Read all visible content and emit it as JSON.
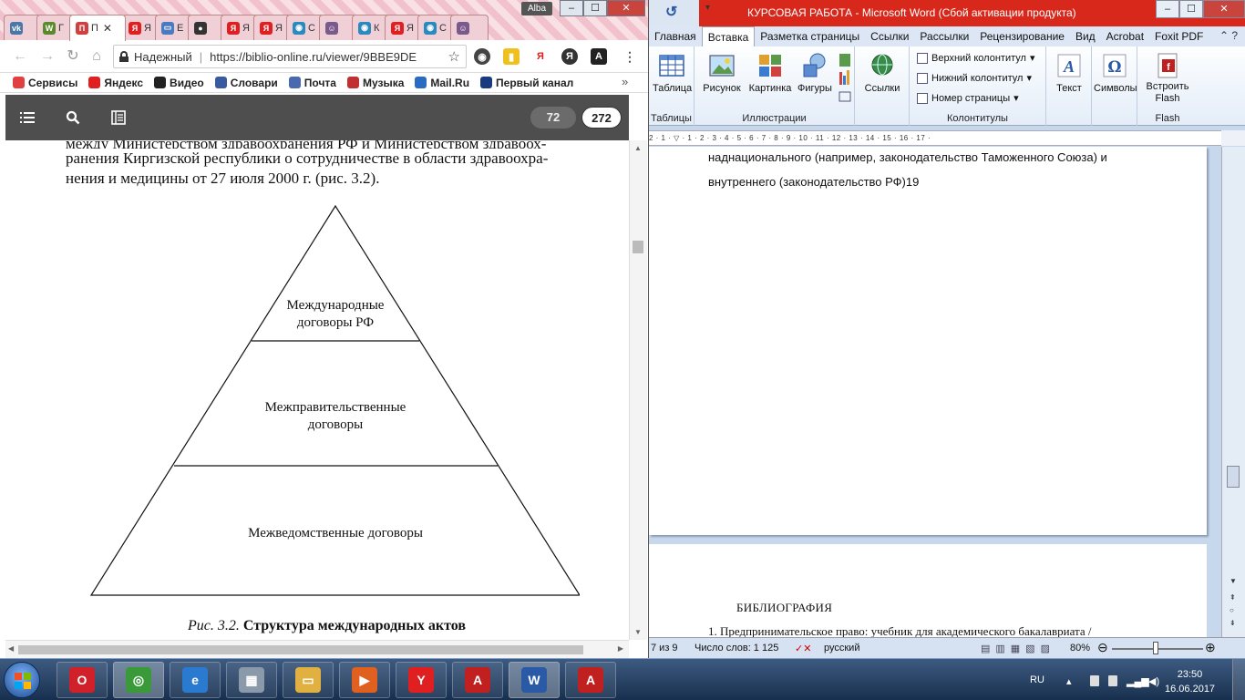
{
  "chrome": {
    "tabs": [
      {
        "short": "",
        "icon": "vk-icon",
        "color": "#4a76a8",
        "glyph": "vk"
      },
      {
        "short": "Г",
        "icon": "green-flag-icon",
        "color": "#5a8a2a",
        "glyph": "W"
      },
      {
        "short": "П",
        "icon": "book-icon",
        "color": "#d04040",
        "glyph": "П",
        "active": true
      },
      {
        "short": "Я",
        "icon": "yandex-icon",
        "color": "#e02020",
        "glyph": "Я"
      },
      {
        "short": "Е",
        "icon": "doc-icon",
        "color": "#4a7ac0",
        "glyph": "▭"
      },
      {
        "short": "",
        "icon": "person-icon",
        "color": "#333333",
        "glyph": "●"
      },
      {
        "short": "Я",
        "icon": "yandex-icon",
        "color": "#e02020",
        "glyph": "Я"
      },
      {
        "short": "Я",
        "icon": "yandex-icon",
        "color": "#e02020",
        "glyph": "Я"
      },
      {
        "short": "С",
        "icon": "globe-icon",
        "color": "#2a8ac0",
        "glyph": "◉"
      },
      {
        "short": "",
        "icon": "avatar-icon",
        "color": "#7a5a8a",
        "glyph": "☺"
      },
      {
        "short": "К",
        "icon": "globe-icon",
        "color": "#2a8ac0",
        "glyph": "◉"
      },
      {
        "short": "Я",
        "icon": "yandex-icon",
        "color": "#e02020",
        "glyph": "Я"
      },
      {
        "short": "С",
        "icon": "globe-icon",
        "color": "#2a8ac0",
        "glyph": "◉"
      },
      {
        "short": "",
        "icon": "avatar-icon",
        "color": "#7a5a8a",
        "glyph": "☺"
      }
    ],
    "active_tab_close": "✕",
    "profile": "Alba",
    "window_controls": {
      "minimize": "–",
      "maximize": "☐",
      "close": "✕"
    },
    "address": {
      "security_label": "Надежный",
      "url": "https://biblio-online.ru/viewer/9BBE9DE"
    },
    "bookmarks": [
      {
        "label": "Сервисы",
        "icon": "apps-grid-icon",
        "color": "#e04040"
      },
      {
        "label": "Яндекс",
        "icon": "yandex-icon",
        "color": "#e02020"
      },
      {
        "label": "Видео",
        "icon": "video-icon",
        "color": "#222222"
      },
      {
        "label": "Словари",
        "icon": "dictionary-icon",
        "color": "#3a5aa0"
      },
      {
        "label": "Почта",
        "icon": "mail-icon",
        "color": "#4a6ab0"
      },
      {
        "label": "Музыка",
        "icon": "music-icon",
        "color": "#c03030"
      },
      {
        "label": "Mail.Ru",
        "icon": "mailru-icon",
        "color": "#2a6ac0"
      },
      {
        "label": "Первый канал",
        "icon": "channel-one-icon",
        "color": "#1a3a80"
      }
    ],
    "bookmarks_more": "»",
    "reader": {
      "current_page": "72",
      "total_pages": "272"
    },
    "document": {
      "line_cut": "между Министерством здравоохранения РФ и Министерством здравоох-",
      "line2": "ранения Киргизской республики о сотрудничестве в области здравоохра-",
      "line3": "нения и медицины от 27 июля 2000 г. (рис. 3.2).",
      "pyramid_levels": {
        "top_line1": "Международные",
        "top_line2": "договоры РФ",
        "middle_line1": "Межправительственные",
        "middle_line2": "договоры",
        "bottom": "Межведомственные договоры"
      },
      "caption_number": "Рис. 3.2.",
      "caption_title": "Структура международных актов"
    }
  },
  "word": {
    "title": "КУРСОВАЯ РАБОТА  -  Microsoft Word (Сбой активации продукта)",
    "qat_icon": "undo-icon",
    "window_controls": {
      "minimize": "–",
      "maximize": "☐",
      "close": "✕"
    },
    "tabs": [
      "Главная",
      "Вставка",
      "Разметка страницы",
      "Ссылки",
      "Рассылки",
      "Рецензирование",
      "Вид",
      "Acrobat",
      "Foxit PDF"
    ],
    "active_tab": "Вставка",
    "ribbon": {
      "tables": {
        "button": "Таблица",
        "group": "Таблицы"
      },
      "illustrations": {
        "picture": "Рисунок",
        "clipart": "Картинка",
        "shapes": "Фигуры",
        "group": "Иллюстрации"
      },
      "links": {
        "button": "Ссылки"
      },
      "header_footer": {
        "header": "Верхний колонтитул",
        "footer": "Нижний колонтитул",
        "page_number": "Номер страницы",
        "group": "Колонтитулы"
      },
      "text": {
        "button": "Текст"
      },
      "symbols": {
        "button": "Символы"
      },
      "flash": {
        "button_line1": "Встроить",
        "button_line2": "Flash",
        "group": "Flash"
      }
    },
    "ruler": "2 · 1 · ▽ · 1 · 2 · 3 · 4 · 5 · 6 · 7 · 8 · 9 · 10 · 11 · 12 · 13 · 14 · 15 · 16 · 17 ·",
    "page1_text": {
      "line1": "наднационального (например, законодательство Таможенного Союза) и",
      "line2": "внутреннего (законодательство РФ)19"
    },
    "page2": {
      "heading": "БИБЛИОГРАФИЯ",
      "item1": "1.  Предпринимательское право: учебник для академического бакалавриата /"
    },
    "status": {
      "page": "7 из 9",
      "words": "Число слов: 1 125",
      "language": "русский",
      "zoom": "80%",
      "zoom_level_percent": 80
    }
  },
  "taskbar": {
    "apps": [
      {
        "name": "opera",
        "icon": "opera-icon",
        "color": "#d0202a",
        "glyph": "O"
      },
      {
        "name": "chrome",
        "icon": "chrome-icon",
        "color": "#3a9a3a",
        "glyph": "◎",
        "active": true
      },
      {
        "name": "ie",
        "icon": "internet-explorer-icon",
        "color": "#2a7ad0",
        "glyph": "e"
      },
      {
        "name": "calculator",
        "icon": "calculator-icon",
        "color": "#8a9aaa",
        "glyph": "▦"
      },
      {
        "name": "explorer",
        "icon": "folder-icon",
        "color": "#e0b040",
        "glyph": "▭"
      },
      {
        "name": "media",
        "icon": "media-player-icon",
        "color": "#e06020",
        "glyph": "▶"
      },
      {
        "name": "yandex",
        "icon": "yandex-browser-icon",
        "color": "#e02020",
        "glyph": "Y"
      },
      {
        "name": "acrobat",
        "icon": "acrobat-icon",
        "color": "#c02020",
        "glyph": "A"
      },
      {
        "name": "word",
        "icon": "word-icon",
        "color": "#2a5aa6",
        "glyph": "W",
        "active": true
      },
      {
        "name": "pdf",
        "icon": "pdf-icon",
        "color": "#c02020",
        "glyph": "A"
      }
    ],
    "tray": {
      "language": "RU",
      "time": "23:50",
      "date": "16.06.2017"
    }
  }
}
